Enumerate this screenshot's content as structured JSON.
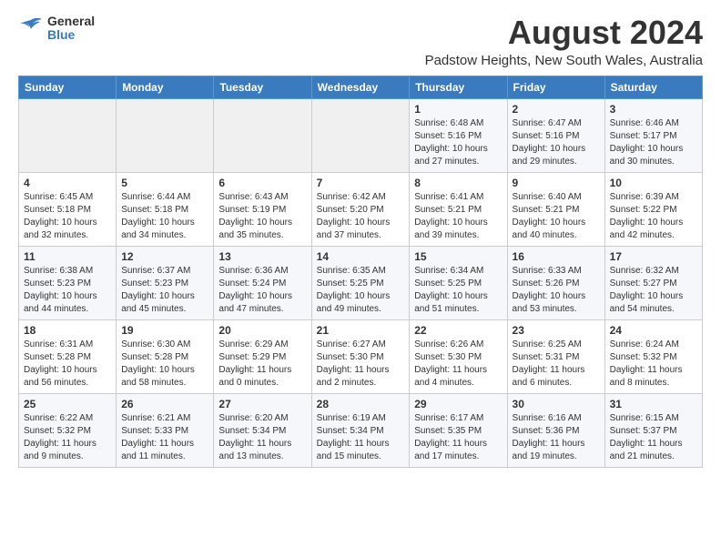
{
  "header": {
    "logo_general": "General",
    "logo_blue": "Blue",
    "title": "August 2024",
    "subtitle": "Padstow Heights, New South Wales, Australia"
  },
  "calendar": {
    "weekdays": [
      "Sunday",
      "Monday",
      "Tuesday",
      "Wednesday",
      "Thursday",
      "Friday",
      "Saturday"
    ],
    "weeks": [
      [
        {
          "day": "",
          "info": ""
        },
        {
          "day": "",
          "info": ""
        },
        {
          "day": "",
          "info": ""
        },
        {
          "day": "",
          "info": ""
        },
        {
          "day": "1",
          "info": "Sunrise: 6:48 AM\nSunset: 5:16 PM\nDaylight: 10 hours\nand 27 minutes."
        },
        {
          "day": "2",
          "info": "Sunrise: 6:47 AM\nSunset: 5:16 PM\nDaylight: 10 hours\nand 29 minutes."
        },
        {
          "day": "3",
          "info": "Sunrise: 6:46 AM\nSunset: 5:17 PM\nDaylight: 10 hours\nand 30 minutes."
        }
      ],
      [
        {
          "day": "4",
          "info": "Sunrise: 6:45 AM\nSunset: 5:18 PM\nDaylight: 10 hours\nand 32 minutes."
        },
        {
          "day": "5",
          "info": "Sunrise: 6:44 AM\nSunset: 5:18 PM\nDaylight: 10 hours\nand 34 minutes."
        },
        {
          "day": "6",
          "info": "Sunrise: 6:43 AM\nSunset: 5:19 PM\nDaylight: 10 hours\nand 35 minutes."
        },
        {
          "day": "7",
          "info": "Sunrise: 6:42 AM\nSunset: 5:20 PM\nDaylight: 10 hours\nand 37 minutes."
        },
        {
          "day": "8",
          "info": "Sunrise: 6:41 AM\nSunset: 5:21 PM\nDaylight: 10 hours\nand 39 minutes."
        },
        {
          "day": "9",
          "info": "Sunrise: 6:40 AM\nSunset: 5:21 PM\nDaylight: 10 hours\nand 40 minutes."
        },
        {
          "day": "10",
          "info": "Sunrise: 6:39 AM\nSunset: 5:22 PM\nDaylight: 10 hours\nand 42 minutes."
        }
      ],
      [
        {
          "day": "11",
          "info": "Sunrise: 6:38 AM\nSunset: 5:23 PM\nDaylight: 10 hours\nand 44 minutes."
        },
        {
          "day": "12",
          "info": "Sunrise: 6:37 AM\nSunset: 5:23 PM\nDaylight: 10 hours\nand 45 minutes."
        },
        {
          "day": "13",
          "info": "Sunrise: 6:36 AM\nSunset: 5:24 PM\nDaylight: 10 hours\nand 47 minutes."
        },
        {
          "day": "14",
          "info": "Sunrise: 6:35 AM\nSunset: 5:25 PM\nDaylight: 10 hours\nand 49 minutes."
        },
        {
          "day": "15",
          "info": "Sunrise: 6:34 AM\nSunset: 5:25 PM\nDaylight: 10 hours\nand 51 minutes."
        },
        {
          "day": "16",
          "info": "Sunrise: 6:33 AM\nSunset: 5:26 PM\nDaylight: 10 hours\nand 53 minutes."
        },
        {
          "day": "17",
          "info": "Sunrise: 6:32 AM\nSunset: 5:27 PM\nDaylight: 10 hours\nand 54 minutes."
        }
      ],
      [
        {
          "day": "18",
          "info": "Sunrise: 6:31 AM\nSunset: 5:28 PM\nDaylight: 10 hours\nand 56 minutes."
        },
        {
          "day": "19",
          "info": "Sunrise: 6:30 AM\nSunset: 5:28 PM\nDaylight: 10 hours\nand 58 minutes."
        },
        {
          "day": "20",
          "info": "Sunrise: 6:29 AM\nSunset: 5:29 PM\nDaylight: 11 hours\nand 0 minutes."
        },
        {
          "day": "21",
          "info": "Sunrise: 6:27 AM\nSunset: 5:30 PM\nDaylight: 11 hours\nand 2 minutes."
        },
        {
          "day": "22",
          "info": "Sunrise: 6:26 AM\nSunset: 5:30 PM\nDaylight: 11 hours\nand 4 minutes."
        },
        {
          "day": "23",
          "info": "Sunrise: 6:25 AM\nSunset: 5:31 PM\nDaylight: 11 hours\nand 6 minutes."
        },
        {
          "day": "24",
          "info": "Sunrise: 6:24 AM\nSunset: 5:32 PM\nDaylight: 11 hours\nand 8 minutes."
        }
      ],
      [
        {
          "day": "25",
          "info": "Sunrise: 6:22 AM\nSunset: 5:32 PM\nDaylight: 11 hours\nand 9 minutes."
        },
        {
          "day": "26",
          "info": "Sunrise: 6:21 AM\nSunset: 5:33 PM\nDaylight: 11 hours\nand 11 minutes."
        },
        {
          "day": "27",
          "info": "Sunrise: 6:20 AM\nSunset: 5:34 PM\nDaylight: 11 hours\nand 13 minutes."
        },
        {
          "day": "28",
          "info": "Sunrise: 6:19 AM\nSunset: 5:34 PM\nDaylight: 11 hours\nand 15 minutes."
        },
        {
          "day": "29",
          "info": "Sunrise: 6:17 AM\nSunset: 5:35 PM\nDaylight: 11 hours\nand 17 minutes."
        },
        {
          "day": "30",
          "info": "Sunrise: 6:16 AM\nSunset: 5:36 PM\nDaylight: 11 hours\nand 19 minutes."
        },
        {
          "day": "31",
          "info": "Sunrise: 6:15 AM\nSunset: 5:37 PM\nDaylight: 11 hours\nand 21 minutes."
        }
      ]
    ]
  }
}
